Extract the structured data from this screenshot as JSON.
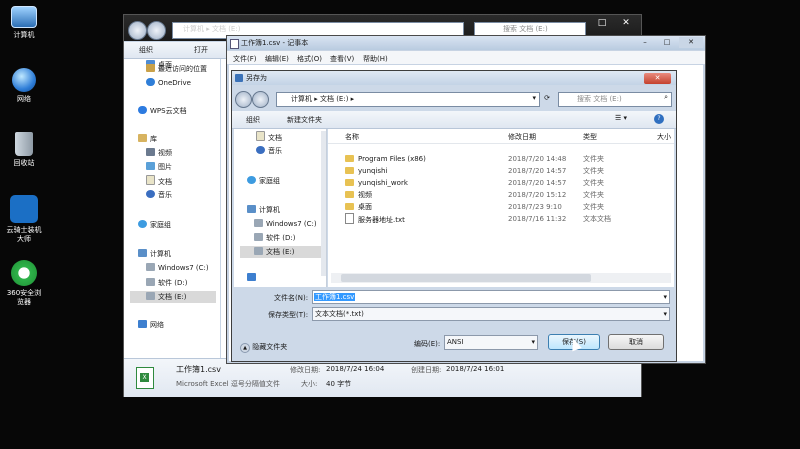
{
  "desktop": {
    "icons": [
      {
        "label": "计算机"
      },
      {
        "label": "网络"
      },
      {
        "label": "回收站"
      },
      {
        "label": "云骑士装机大师"
      },
      {
        "label": "360安全浏览器"
      }
    ]
  },
  "explorer": {
    "address": [
      "计算机",
      "文档 (E:)"
    ],
    "search_placeholder": "搜索 文档 (E:)",
    "toolbar": {
      "organize": "组织",
      "open": "打开"
    },
    "nav": {
      "favorites": [
        "桌面",
        "最近访问的位置"
      ],
      "onedrive": "OneDrive",
      "wps": "WPS云文档",
      "library": "库",
      "library_items": [
        "视频",
        "图片",
        "文档",
        "音乐"
      ],
      "homegroup": "家庭组",
      "computer": "计算机",
      "drives": [
        "Windows7 (C:)",
        "软件 (D:)",
        "文档 (E:)"
      ],
      "network": "网络"
    },
    "details": {
      "file_name": "工作簿1.csv",
      "file_type": "Microsoft Excel 逗号分隔值文件",
      "modified_label": "修改日期:",
      "modified": "2018/7/24 16:04",
      "created_label": "创建日期:",
      "created": "2018/7/24 16:01",
      "size_label": "大小:",
      "size": "40 字节"
    }
  },
  "notepad": {
    "title": "工作簿1.csv - 记事本",
    "menu": [
      "文件(F)",
      "编辑(E)",
      "格式(O)",
      "查看(V)",
      "帮助(H)"
    ]
  },
  "save_dialog": {
    "title": "另存为",
    "address": [
      "计算机",
      "文档 (E:)"
    ],
    "search_placeholder": "搜索 文档 (E:)",
    "toolbar": {
      "organize": "组织",
      "new_folder": "新建文件夹"
    },
    "nav": {
      "items_top": [
        "文档",
        "音乐"
      ],
      "homegroup": "家庭组",
      "computer": "计算机",
      "drives": [
        "Windows7 (C:)",
        "软件 (D:)",
        "文档 (E:)"
      ]
    },
    "columns": [
      "名称",
      "修改日期",
      "类型",
      "大小"
    ],
    "files": [
      {
        "name": "Program Files (x86)",
        "date": "2018/7/20 14:48",
        "type": "文件夹",
        "kind": "folder"
      },
      {
        "name": "yunqishi",
        "date": "2018/7/20 14:57",
        "type": "文件夹",
        "kind": "folder"
      },
      {
        "name": "yunqishi_work",
        "date": "2018/7/20 14:57",
        "type": "文件夹",
        "kind": "folder"
      },
      {
        "name": "视频",
        "date": "2018/7/20 15:12",
        "type": "文件夹",
        "kind": "folder"
      },
      {
        "name": "桌面",
        "date": "2018/7/23 9:10",
        "type": "文件夹",
        "kind": "folder"
      },
      {
        "name": "服务器地址.txt",
        "date": "2018/7/16 11:32",
        "type": "文本文档",
        "kind": "txt"
      }
    ],
    "filename_label": "文件名(N):",
    "filename_value": "工作簿1.csv",
    "savetype_label": "保存类型(T):",
    "savetype_value": "文本文档(*.txt)",
    "hide_folders": "隐藏文件夹",
    "encoding_label": "编码(E):",
    "encoding_value": "ANSI",
    "save_button": "保存(S)",
    "cancel_button": "取消"
  },
  "colors": {
    "accent": "#3399ff",
    "folder": "#e8c253",
    "selection": "#3399ff"
  }
}
